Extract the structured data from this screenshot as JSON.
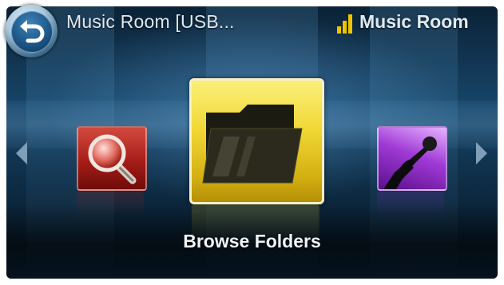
{
  "header": {
    "title": "Music Room [USB...",
    "room_name": "Music Room",
    "back_icon": "back-arrow-icon",
    "signal_icon": "signal-bars-icon",
    "signal_color": "#f0c200"
  },
  "carousel": {
    "selected_label": "Browse Folders",
    "items": [
      {
        "icon": "search-magnifier-icon",
        "color": "#a61d18"
      },
      {
        "icon": "folder-icon",
        "color": "#f1d835"
      },
      {
        "icon": "karaoke-microphone-icon",
        "color": "#a03ad6"
      }
    ],
    "prev_icon": "chevron-left-icon",
    "next_icon": "chevron-right-icon"
  }
}
